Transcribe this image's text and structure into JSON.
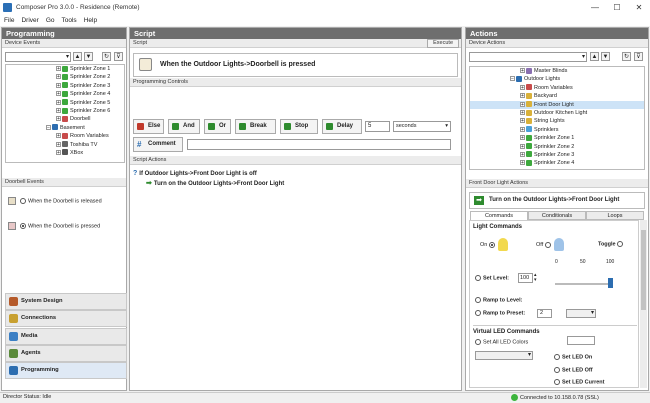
{
  "window": {
    "title": "Composer Pro 3.0.0 - Residence (Remote)",
    "minimize": "—",
    "maximize": "☐",
    "close": "✕"
  },
  "menu": [
    "File",
    "Driver",
    "Go",
    "Tools",
    "Help"
  ],
  "programming": {
    "header": "Programming",
    "device_events_label": "Device Events",
    "tree": [
      {
        "label": "Sprinkler Zone 1",
        "kind": "check",
        "indent": 1
      },
      {
        "label": "Sprinkler Zone 2",
        "kind": "check",
        "indent": 1
      },
      {
        "label": "Sprinkler Zone 3",
        "kind": "check",
        "indent": 1
      },
      {
        "label": "Sprinkler Zone 4",
        "kind": "check",
        "indent": 1
      },
      {
        "label": "Sprinkler Zone 5",
        "kind": "check",
        "indent": 1
      },
      {
        "label": "Sprinkler Zone 6",
        "kind": "check",
        "indent": 1
      },
      {
        "label": "Doorbell",
        "kind": "doorbell",
        "indent": 1
      },
      {
        "label": "Basement",
        "kind": "room",
        "indent": 0
      },
      {
        "label": "Room Variables",
        "kind": "variables",
        "indent": 1
      },
      {
        "label": "Toshiba TV",
        "kind": "tv",
        "indent": 1
      },
      {
        "label": "XBox",
        "kind": "game",
        "indent": 1
      }
    ],
    "doorbell_events_label": "Doorbell Events",
    "events": [
      {
        "label": "When the Doorbell is released",
        "selected": false
      },
      {
        "label": "When the Doorbell is pressed",
        "selected": true
      }
    ],
    "nav": [
      {
        "label": "System Design",
        "color": "#b55a2a"
      },
      {
        "label": "Connections",
        "color": "#c8a030"
      },
      {
        "label": "Media",
        "color": "#3b7fc4"
      },
      {
        "label": "Agents",
        "color": "#5a8a3a"
      },
      {
        "label": "Programming",
        "color": "#2c6db0"
      }
    ]
  },
  "script": {
    "header": "Script",
    "sub_label": "Script",
    "execute": "Execute",
    "event_title": "When the Outdoor Lights->Doorbell is pressed",
    "controls_label": "Programming Controls",
    "buttons": [
      {
        "label": "Else",
        "color": "#c0392b"
      },
      {
        "label": "And",
        "color": "#2e8b2e"
      },
      {
        "label": "Or",
        "color": "#2e8b2e"
      },
      {
        "label": "Break",
        "color": "#2e8b2e"
      },
      {
        "label": "Stop",
        "color": "#2e8b2e"
      },
      {
        "label": "Delay",
        "color": "#2e8b2e"
      }
    ],
    "delay_value": "5",
    "delay_unit": "seconds",
    "comment_label": "Comment",
    "actions_label": "Script Actions",
    "lines": [
      "If Outdoor Lights->Front Door Light is off",
      "Turn on the Outdoor Lights->Front Door Light"
    ]
  },
  "actions": {
    "header": "Actions",
    "device_actions_label": "Device Actions",
    "tree": [
      {
        "label": "Master Blinds",
        "kind": "blinds",
        "indent": 2,
        "selected": false
      },
      {
        "label": "Outdoor Lights",
        "kind": "room",
        "indent": 1,
        "selected": false
      },
      {
        "label": "Room Variables",
        "kind": "variables",
        "indent": 2,
        "selected": false
      },
      {
        "label": "Backyard",
        "kind": "light",
        "indent": 2,
        "selected": false
      },
      {
        "label": "Front Door Light",
        "kind": "light",
        "indent": 2,
        "selected": true
      },
      {
        "label": "Outdoor Kitchen Light",
        "kind": "light",
        "indent": 2,
        "selected": false
      },
      {
        "label": "String Lights",
        "kind": "light",
        "indent": 2,
        "selected": false
      },
      {
        "label": "Sprinklers",
        "kind": "sprinkler",
        "indent": 2,
        "selected": false
      },
      {
        "label": "Sprinkler Zone 1",
        "kind": "check",
        "indent": 2,
        "selected": false
      },
      {
        "label": "Sprinkler Zone 2",
        "kind": "check",
        "indent": 2,
        "selected": false
      },
      {
        "label": "Sprinkler Zone 3",
        "kind": "check",
        "indent": 2,
        "selected": false
      },
      {
        "label": "Sprinkler Zone 4",
        "kind": "check",
        "indent": 2,
        "selected": false
      }
    ],
    "light_actions_label": "Front Door Light Actions",
    "action_title": "Turn on the Outdoor Lights->Front Door Light",
    "tabs": [
      "Commands",
      "Conditionals",
      "Loops"
    ],
    "light_commands_label": "Light Commands",
    "on_label": "On",
    "off_label": "Off",
    "toggle_label": "Toggle",
    "set_level_label": "Set Level:",
    "level_value": "100",
    "slider_ticks": [
      "0",
      "50",
      "100"
    ],
    "slider_level": 1.0,
    "ramp_level_label": "Ramp to Level:",
    "ramp_preset_label": "Ramp to Preset:",
    "ramp_preset_value": "2",
    "virtual_led_label": "Virtual LED Commands",
    "set_all_led_label": "Set All LED Colors",
    "led_on": "Set LED On",
    "led_off": "Set LED Off",
    "led_current": "Set LED Current"
  },
  "status": {
    "left": "Director Status: Idle",
    "right": "Connected to 10.158.0.78 (SSL)"
  }
}
